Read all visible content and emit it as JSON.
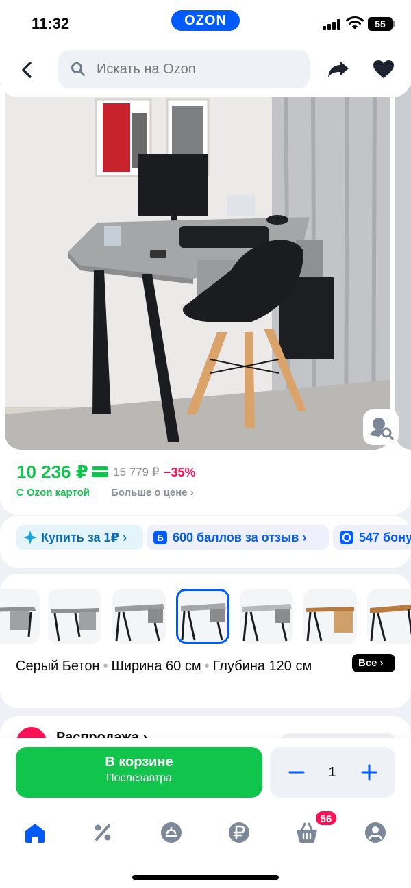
{
  "status_bar": {
    "time": "11:32",
    "battery": "55",
    "brand": "OZON"
  },
  "nav": {
    "search_placeholder": "Искать на Ozon"
  },
  "product": {
    "price": "10 236 ₽",
    "old_price": "15 779 ₽",
    "discount": "−35%",
    "card_label": "С Ozon картой",
    "more_price": "Больше о цене ›"
  },
  "chips": [
    {
      "label": "Купить за 1₽ ›"
    },
    {
      "label": "600 баллов за отзыв ›"
    },
    {
      "label": "547 бону"
    }
  ],
  "variants": {
    "attributes": [
      "Серый Бетон",
      "Ширина 60 см",
      "Глубина 120 см"
    ],
    "all_label": "Все ›"
  },
  "seller": {
    "name": "Распродажа ›"
  },
  "buy": {
    "cart_label": "В корзине",
    "delivery": "Послезавтра",
    "quantity": "1"
  },
  "tabbar": {
    "cart_badge": "56"
  },
  "colors": {
    "accent": "#005bff",
    "green": "#10c44c",
    "pink": "#f91155"
  }
}
